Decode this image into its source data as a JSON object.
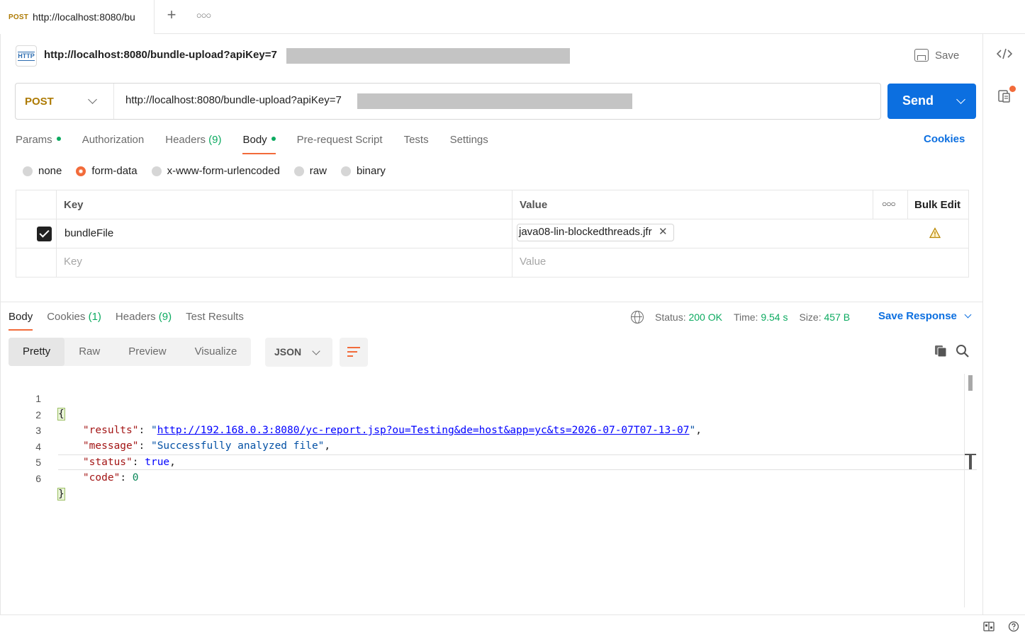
{
  "tab": {
    "method": "POST",
    "title": "http://localhost:8080/bu"
  },
  "request": {
    "icon_label": "HTTP",
    "title": "http://localhost:8080/bundle-upload?apiKey=7",
    "save_label": "Save",
    "method": "POST",
    "url": "http://localhost:8080/bundle-upload?apiKey=7",
    "send_label": "Send"
  },
  "request_tabs": {
    "params": "Params",
    "authorization": "Authorization",
    "headers": "Headers",
    "headers_count": "(9)",
    "body": "Body",
    "pre_request": "Pre-request Script",
    "tests": "Tests",
    "settings": "Settings",
    "cookies": "Cookies"
  },
  "body_types": {
    "none": "none",
    "form_data": "form-data",
    "urlencoded": "x-www-form-urlencoded",
    "raw": "raw",
    "binary": "binary",
    "selected": "form-data"
  },
  "params_table": {
    "key_header": "Key",
    "value_header": "Value",
    "bulk_edit": "Bulk Edit",
    "rows": [
      {
        "checked": true,
        "key": "bundleFile",
        "value": "java08-lin-blockedthreads.jfr"
      }
    ],
    "key_placeholder": "Key",
    "value_placeholder": "Value"
  },
  "response_tabs": {
    "body": "Body",
    "cookies": "Cookies",
    "cookies_count": "(1)",
    "headers": "Headers",
    "headers_count": "(9)",
    "test_results": "Test Results"
  },
  "response_status": {
    "status_label": "Status:",
    "status_value": "200 OK",
    "time_label": "Time:",
    "time_value": "9.54 s",
    "size_label": "Size:",
    "size_value": "457 B",
    "save_response": "Save Response"
  },
  "view_modes": {
    "pretty": "Pretty",
    "raw": "Raw",
    "preview": "Preview",
    "visualize": "Visualize",
    "format": "JSON"
  },
  "response_body": {
    "line_numbers": [
      "1",
      "2",
      "3",
      "4",
      "5",
      "6"
    ],
    "open_brace": "{",
    "close_brace": "}",
    "results_key": "\"results\"",
    "results_value": "http://192.168.0.3:8080/yc-report.jsp?ou=Testing&de=host&app=yc&ts=2026-07-07T07-13-07",
    "message_key": "\"message\"",
    "message_value": "\"Successfully analyzed file\"",
    "status_key": "\"status\"",
    "status_value": "true",
    "code_key": "\"code\"",
    "code_value": "0"
  },
  "colors": {
    "accent": "#f26b3a",
    "primary": "#0c6fe0",
    "success": "#0caa60",
    "method_post": "#ad7a03"
  }
}
